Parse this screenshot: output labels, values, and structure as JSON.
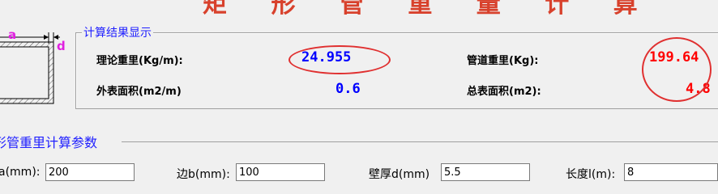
{
  "window": {
    "title": "矩 形 管 重 量 计 算"
  },
  "diagram": {
    "label_a": "a",
    "label_d": "d"
  },
  "results": {
    "group_title": "计算结果显示",
    "theory_weight_label": "理论重里(Kg/m):",
    "theory_weight_value": "24.955",
    "pipe_weight_label": "管道重里(Kg):",
    "pipe_weight_value": "199.64",
    "outer_area_label": "外表面积(m2/m)",
    "outer_area_value": "0.6",
    "total_area_label": "总表面积(m2):",
    "total_area_value": "4.8"
  },
  "params": {
    "group_title": "形管重里计算参数",
    "side_a_label": "a(mm):",
    "side_a_value": "200",
    "side_b_label": "边b(mm):",
    "side_b_value": "100",
    "wall_label": "壁厚d(mm)",
    "wall_value": "5.5",
    "length_label": "长度l(m):",
    "length_value": "8"
  },
  "colors": {
    "title": "#d8412c",
    "group_title": "#2020ff",
    "value_blue": "#0000ff",
    "value_red": "#ff0000",
    "annotation": "#e03030"
  }
}
